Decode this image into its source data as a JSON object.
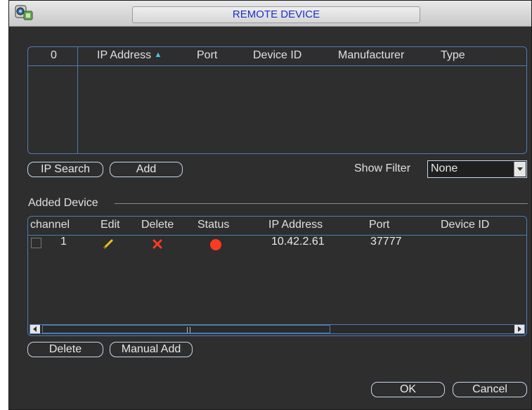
{
  "window": {
    "title": "REMOTE DEVICE"
  },
  "search_table": {
    "columns": [
      "0",
      "IP Address",
      "Port",
      "Device ID",
      "Manufacturer",
      "Type"
    ],
    "sort_indicator": "▲"
  },
  "buttons": {
    "ip_search": "IP Search",
    "add": "Add",
    "delete": "Delete",
    "manual_add": "Manual Add",
    "ok": "OK",
    "cancel": "Cancel"
  },
  "filter": {
    "label": "Show Filter",
    "value": "None"
  },
  "added_device": {
    "section_label": "Added Device",
    "columns": [
      "channel",
      "Edit",
      "Delete",
      "Status",
      "IP Address",
      "Port",
      "Device ID"
    ],
    "rows": [
      {
        "channel": "1",
        "ip": "10.42.2.61",
        "port": "37777",
        "device_id": "",
        "status_color": "#ff3b1f"
      }
    ]
  },
  "colors": {
    "accent_blue": "#4f7bb5",
    "title_text": "#1a2fc8",
    "edit_icon": "#f2c21a",
    "delete_icon": "#ff3b1f"
  }
}
